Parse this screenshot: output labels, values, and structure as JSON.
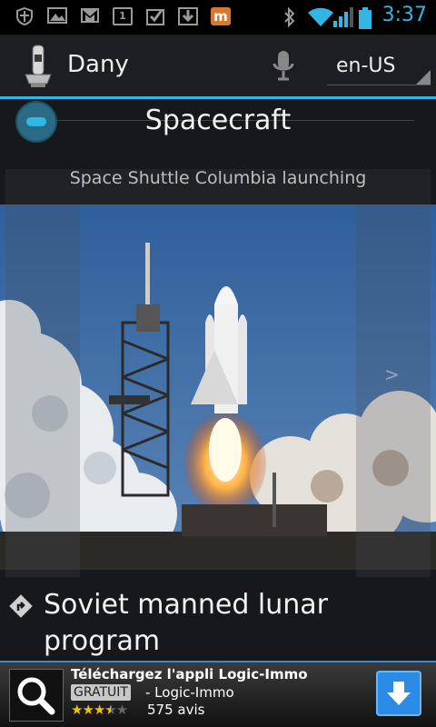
{
  "status_bar": {
    "time": "3:37",
    "icons": [
      "shield-icon",
      "image-icon",
      "gmail-icon",
      "calendar-icon",
      "task-check-icon",
      "download-icon",
      "app-m-icon",
      "bluetooth-icon",
      "wifi-icon",
      "signal-icon",
      "battery-icon"
    ],
    "calendar_day": "1",
    "app_letter": "m"
  },
  "action_bar": {
    "user": "Dany",
    "language": "en-US",
    "accent_color": "#33b5e5"
  },
  "category": {
    "title": "Spacecraft"
  },
  "card": {
    "caption": "Space Shuttle Columbia launching",
    "next_glyph": ">"
  },
  "item": {
    "title": "Soviet manned lunar program"
  },
  "ad": {
    "title": "Téléchargez l'appli Logic-Immo",
    "badge": "GRATUIT",
    "company": "- Logic-Immo",
    "rating": 3.5,
    "stars_display": "★★★★☆",
    "reviews": "575 avis"
  }
}
